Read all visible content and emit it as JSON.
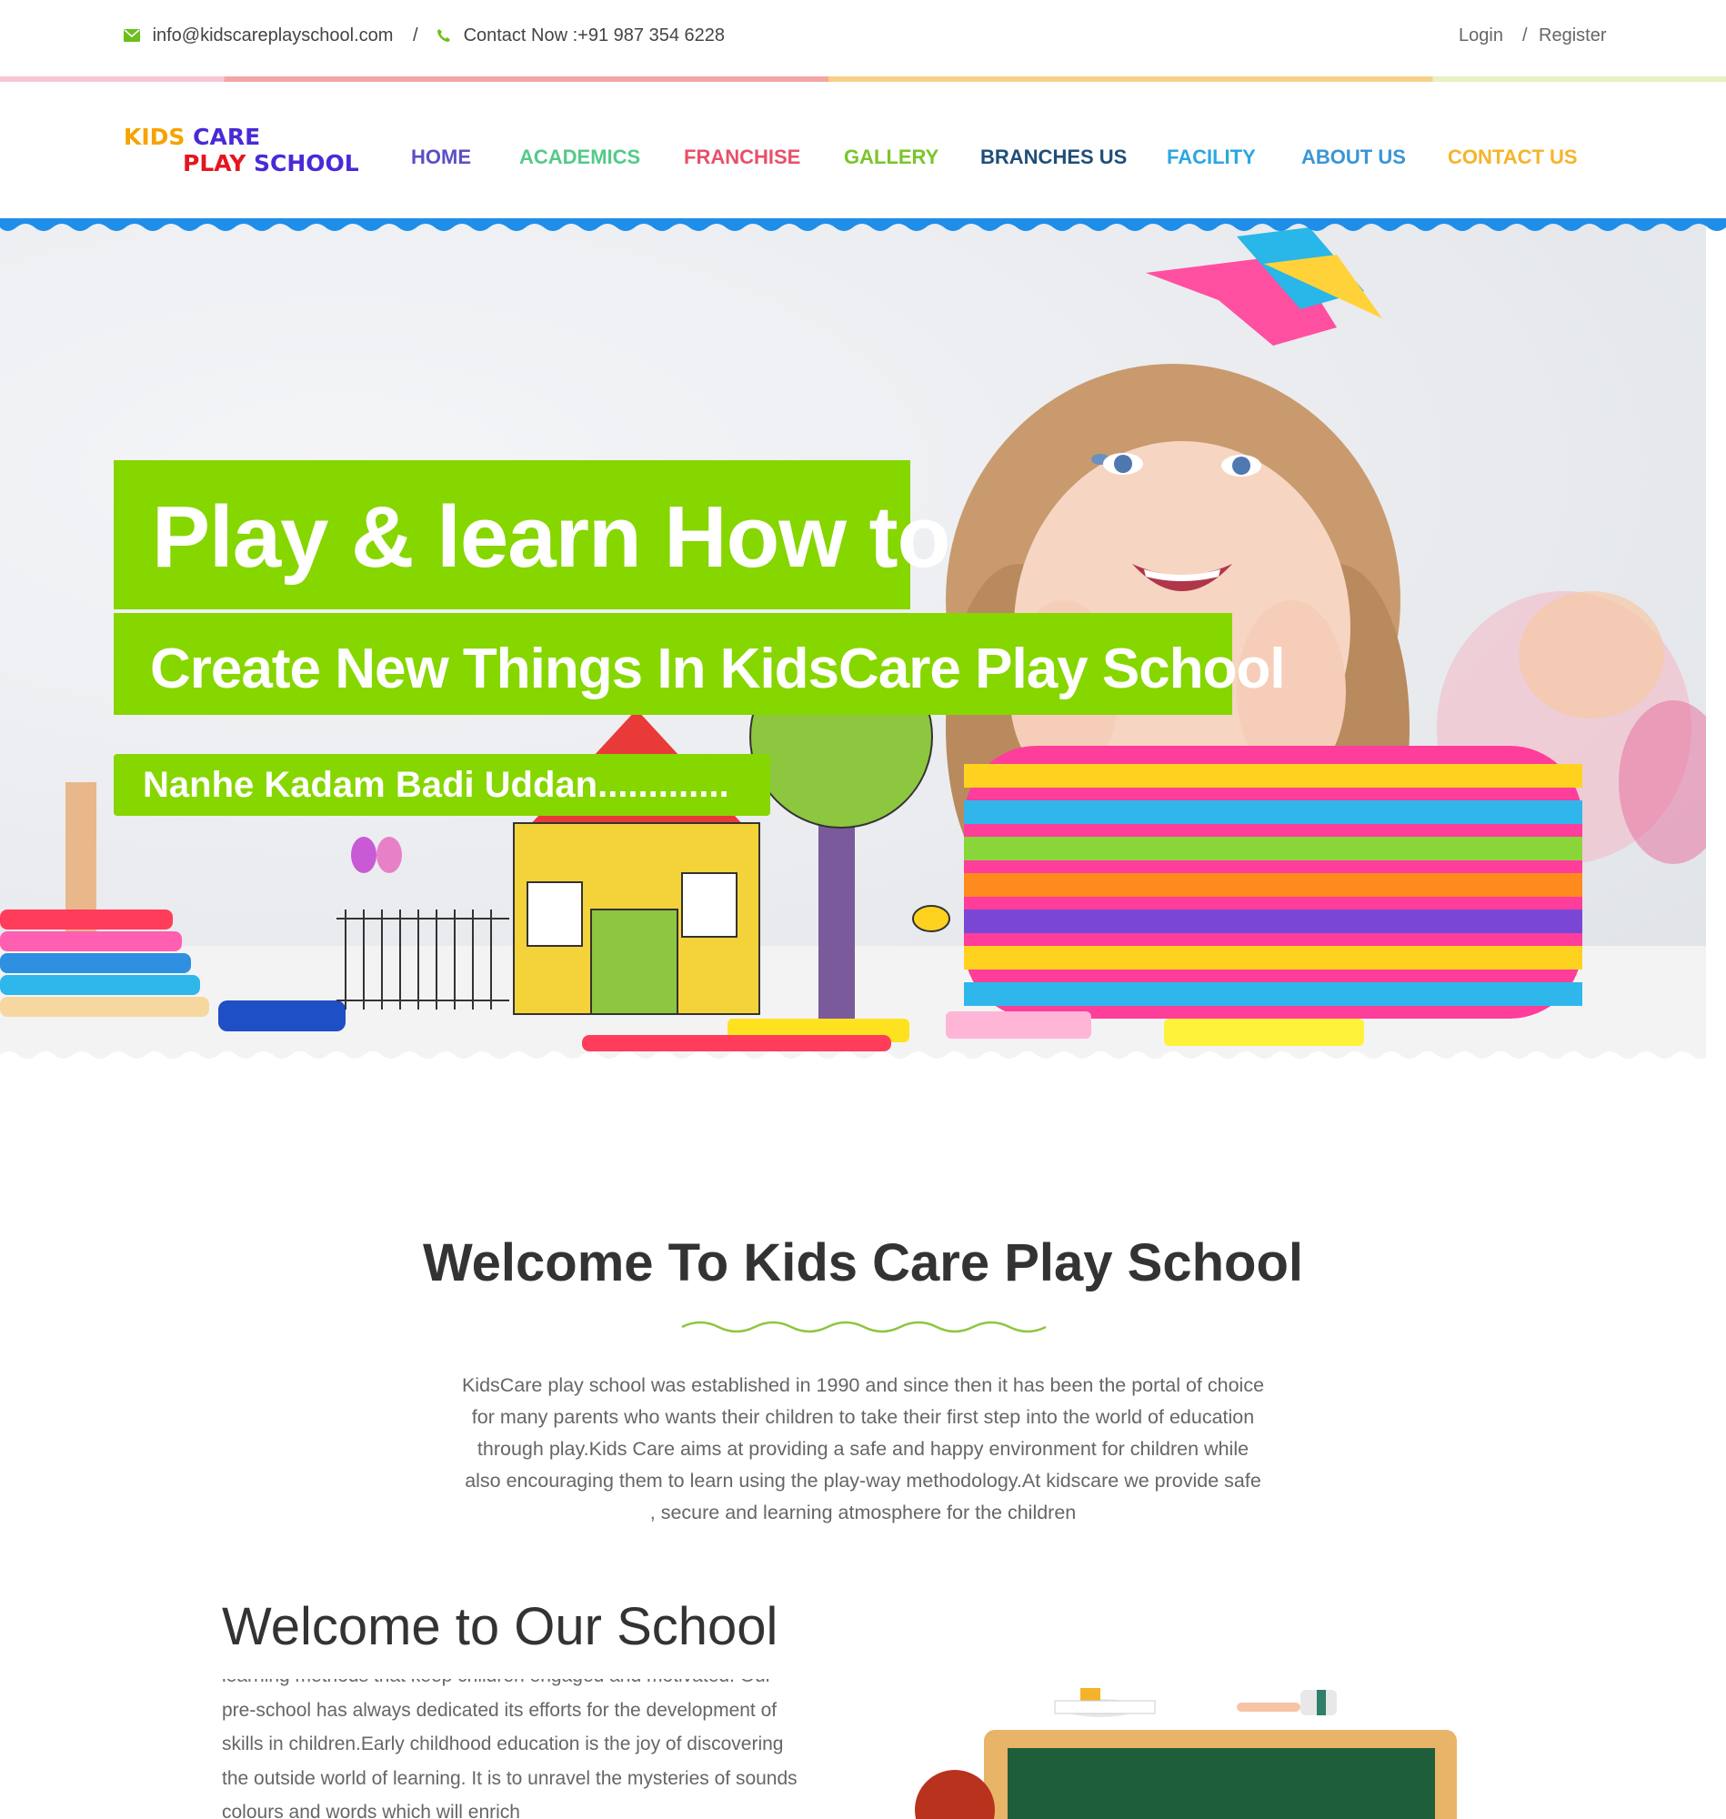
{
  "topbar": {
    "email": "info@kidscareplayschool.com",
    "separator": "/",
    "contact": "Contact Now :+91 987 354 6228",
    "login": "Login",
    "auth_separator": "/",
    "register": "Register"
  },
  "logo": {
    "line1a": "KIDS",
    "line1b": "CARE",
    "line2a": "PLAY",
    "line2b": "SCHOOL"
  },
  "nav": {
    "items": [
      {
        "label": "HOME",
        "color": "#5b4fc4"
      },
      {
        "label": "ACADEMICS",
        "color": "#56c98a"
      },
      {
        "label": "FRANCHISE",
        "color": "#e8506a"
      },
      {
        "label": "GALLERY",
        "color": "#7ac52a"
      },
      {
        "label": "BRANCHES US",
        "color": "#1f4e79"
      },
      {
        "label": "FACILITY",
        "color": "#2aa7e0"
      },
      {
        "label": "ABOUT US",
        "color": "#3a95d6"
      },
      {
        "label": "CONTACT US",
        "color": "#f5b42a"
      }
    ]
  },
  "hero": {
    "line1": "Play & learn How to",
    "line2": "Create New Things In KidsCare Play School",
    "line3": "Nanhe Kadam Badi Uddan.............",
    "accent": "#86d600"
  },
  "welcome": {
    "title": "Welcome To Kids Care Play School",
    "lines": [
      "KidsCare play school was established in 1990 and since then it has been the portal of choice",
      "for many parents who wants their children to take their first step into the world of education",
      "through play.Kids Care aims at providing a safe and happy environment for children while",
      "also encouraging them to learn using the play-way methodology.At kidscare we provide safe",
      ", secure and learning atmosphere for the children"
    ]
  },
  "school": {
    "title": "Welcome to Our School",
    "lines": [
      "learning methods that keep children engaged and motivated. Our",
      "pre-school has always dedicated its efforts for the development of",
      "skills in children.Early childhood education is the joy of discovering",
      "the outside world of learning. It is to unravel the mysteries of sounds",
      "colours and words which will enrich"
    ]
  },
  "icons": {
    "email": "envelope-icon",
    "phone": "phone-icon"
  }
}
